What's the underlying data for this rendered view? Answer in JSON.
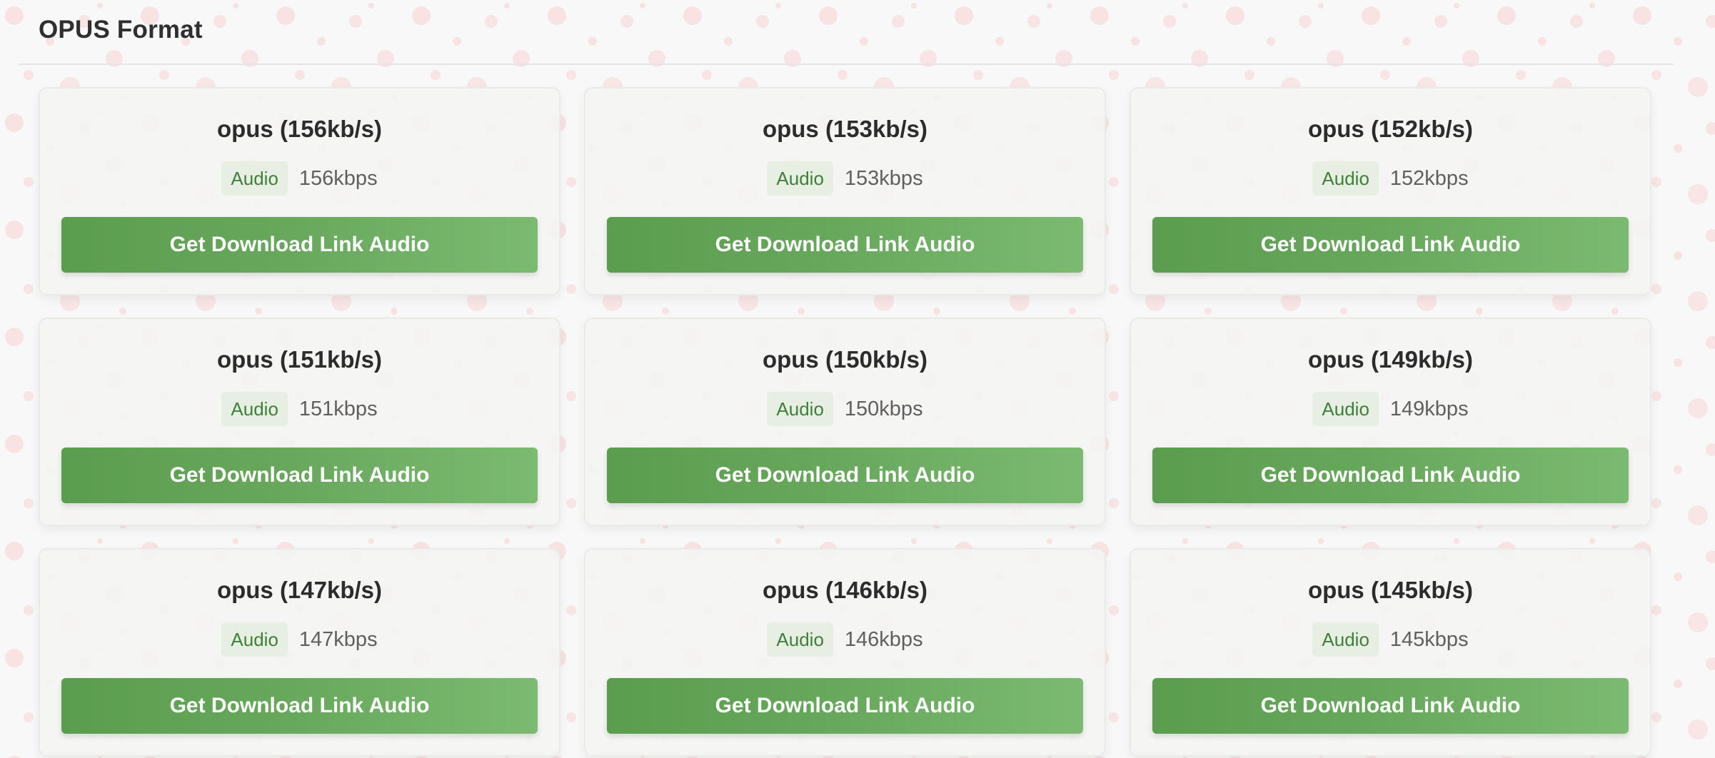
{
  "section": {
    "title": "OPUS Format"
  },
  "colors": {
    "accent_green": "#5b9d4f",
    "badge_bg": "#e6efe2",
    "badge_text": "#3f7f3a",
    "background_dots": "#f7d9d9"
  },
  "formats": [
    {
      "title": "opus (156kb/s)",
      "badge": "Audio",
      "bitrate": "156kbps",
      "button": "Get Download Link Audio"
    },
    {
      "title": "opus (153kb/s)",
      "badge": "Audio",
      "bitrate": "153kbps",
      "button": "Get Download Link Audio"
    },
    {
      "title": "opus (152kb/s)",
      "badge": "Audio",
      "bitrate": "152kbps",
      "button": "Get Download Link Audio"
    },
    {
      "title": "opus (151kb/s)",
      "badge": "Audio",
      "bitrate": "151kbps",
      "button": "Get Download Link Audio"
    },
    {
      "title": "opus (150kb/s)",
      "badge": "Audio",
      "bitrate": "150kbps",
      "button": "Get Download Link Audio"
    },
    {
      "title": "opus (149kb/s)",
      "badge": "Audio",
      "bitrate": "149kbps",
      "button": "Get Download Link Audio"
    },
    {
      "title": "opus (147kb/s)",
      "badge": "Audio",
      "bitrate": "147kbps",
      "button": "Get Download Link Audio"
    },
    {
      "title": "opus (146kb/s)",
      "badge": "Audio",
      "bitrate": "146kbps",
      "button": "Get Download Link Audio"
    },
    {
      "title": "opus (145kb/s)",
      "badge": "Audio",
      "bitrate": "145kbps",
      "button": "Get Download Link Audio"
    }
  ]
}
